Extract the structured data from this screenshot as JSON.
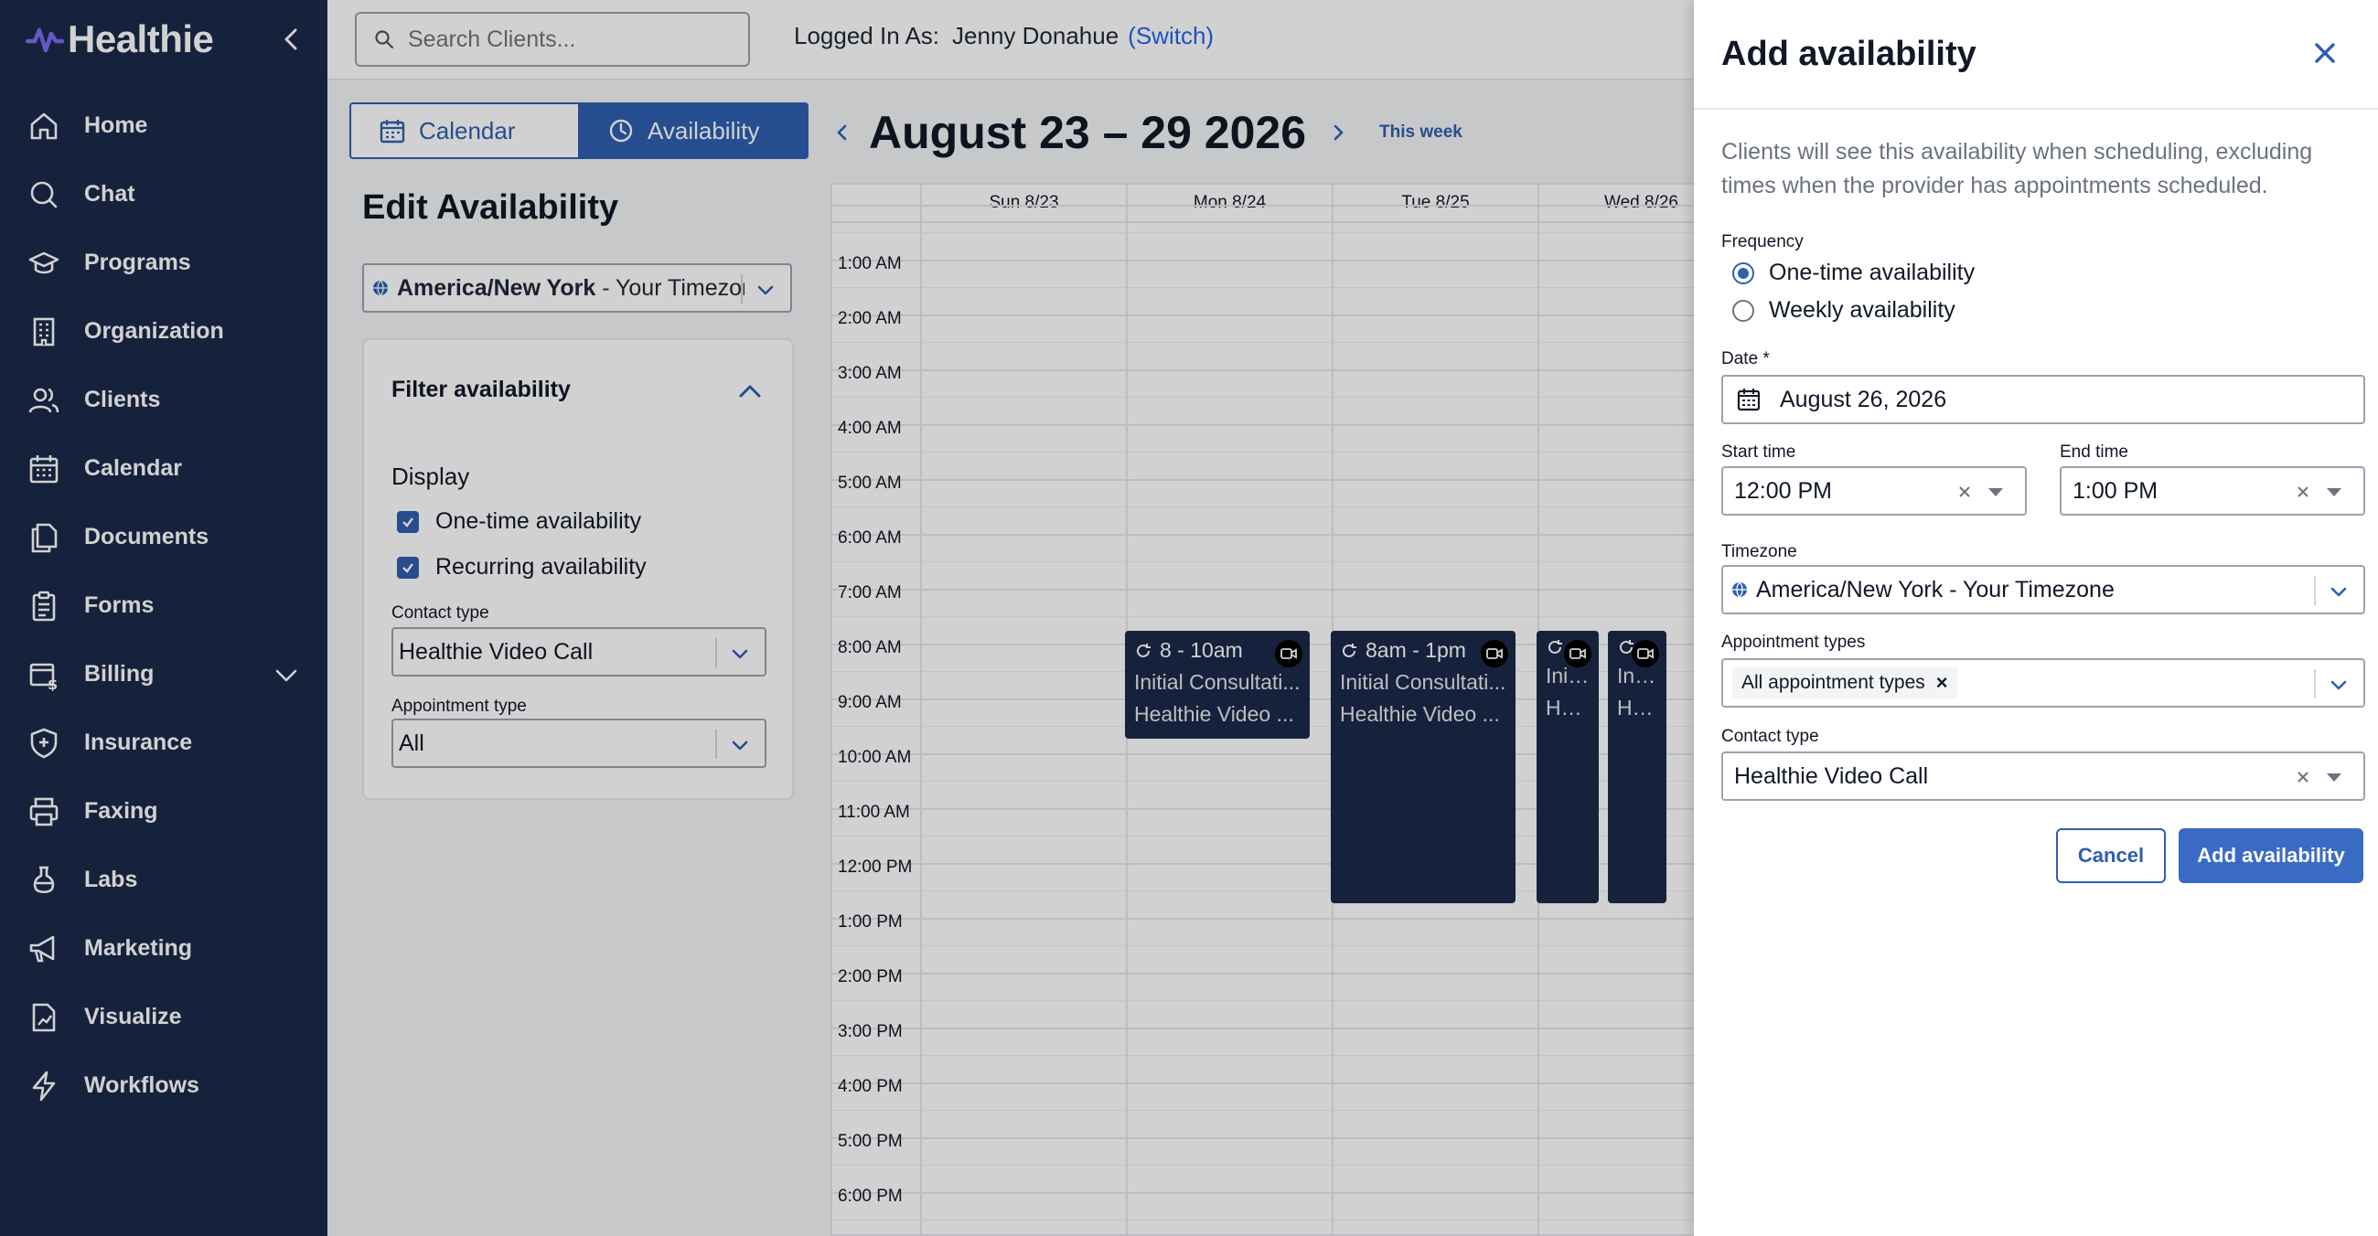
{
  "brand": {
    "name": "Healthie"
  },
  "sidebar": {
    "items": [
      {
        "label": "Home"
      },
      {
        "label": "Chat"
      },
      {
        "label": "Programs"
      },
      {
        "label": "Organization"
      },
      {
        "label": "Clients"
      },
      {
        "label": "Calendar"
      },
      {
        "label": "Documents"
      },
      {
        "label": "Forms"
      },
      {
        "label": "Billing"
      },
      {
        "label": "Insurance"
      },
      {
        "label": "Faxing"
      },
      {
        "label": "Labs"
      },
      {
        "label": "Marketing"
      },
      {
        "label": "Visualize"
      },
      {
        "label": "Workflows"
      }
    ]
  },
  "topbar": {
    "search_placeholder": "Search Clients...",
    "logged_in_label": "Logged In As:",
    "user_name": "Jenny Donahue",
    "switch_label": "(Switch)"
  },
  "view_toggle": {
    "calendar": "Calendar",
    "availability": "Availability"
  },
  "edit_panel": {
    "title": "Edit Availability",
    "timezone_bold": "America/New York",
    "timezone_rest": " - Your Timezone",
    "filter": {
      "heading": "Filter availability",
      "display_label": "Display",
      "one_time": "One-time availability",
      "recurring": "Recurring availability",
      "contact_type_label": "Contact type",
      "contact_type_value": "Healthie Video Call",
      "appointment_type_label": "Appointment type",
      "appointment_type_value": "All"
    }
  },
  "week": {
    "title": "August 23 – 29 2026",
    "this_week": "This week"
  },
  "calendar": {
    "days": [
      "Sun 8/23",
      "Mon 8/24",
      "Tue 8/25",
      "Wed 8/26"
    ],
    "hours": [
      "1:00 AM",
      "2:00 AM",
      "3:00 AM",
      "4:00 AM",
      "5:00 AM",
      "6:00 AM",
      "7:00 AM",
      "8:00 AM",
      "9:00 AM",
      "10:00 AM",
      "11:00 AM",
      "12:00 PM",
      "1:00 PM",
      "2:00 PM",
      "3:00 PM",
      "4:00 PM",
      "5:00 PM",
      "6:00 PM"
    ],
    "events": [
      {
        "time": "8 - 10am",
        "title": "Initial Consultati...",
        "contact": "Healthie Video ..."
      },
      {
        "time": "8am - 1pm",
        "title": "Initial Consultati...",
        "contact": "Healthie Video ..."
      },
      {
        "time": "",
        "title": "Init...",
        "contact": "He..."
      },
      {
        "time": "",
        "title": "Init...",
        "contact": "He..."
      }
    ]
  },
  "add_panel": {
    "title": "Add availability",
    "description": "Clients will see this availability when scheduling, excluding times when the provider has appointments scheduled.",
    "frequency_label": "Frequency",
    "frequency_options": [
      "One-time availability",
      "Weekly availability"
    ],
    "frequency_selected": "One-time availability",
    "date_label": "Date *",
    "date_value": "August 26, 2026",
    "start_time_label": "Start time",
    "start_time_value": "12:00 PM",
    "end_time_label": "End time",
    "end_time_value": "1:00 PM",
    "timezone_label": "Timezone",
    "timezone_value": "America/New York - Your Timezone",
    "appointment_types_label": "Appointment types",
    "appointment_types_tag": "All appointment types",
    "contact_type_label": "Contact type",
    "contact_type_value": "Healthie Video Call",
    "cancel_label": "Cancel",
    "submit_label": "Add availability"
  },
  "colors": {
    "sidebar_bg": "#1b2a4a",
    "accent": "#2f5fb0",
    "event_bg": "#1b2a4a"
  }
}
